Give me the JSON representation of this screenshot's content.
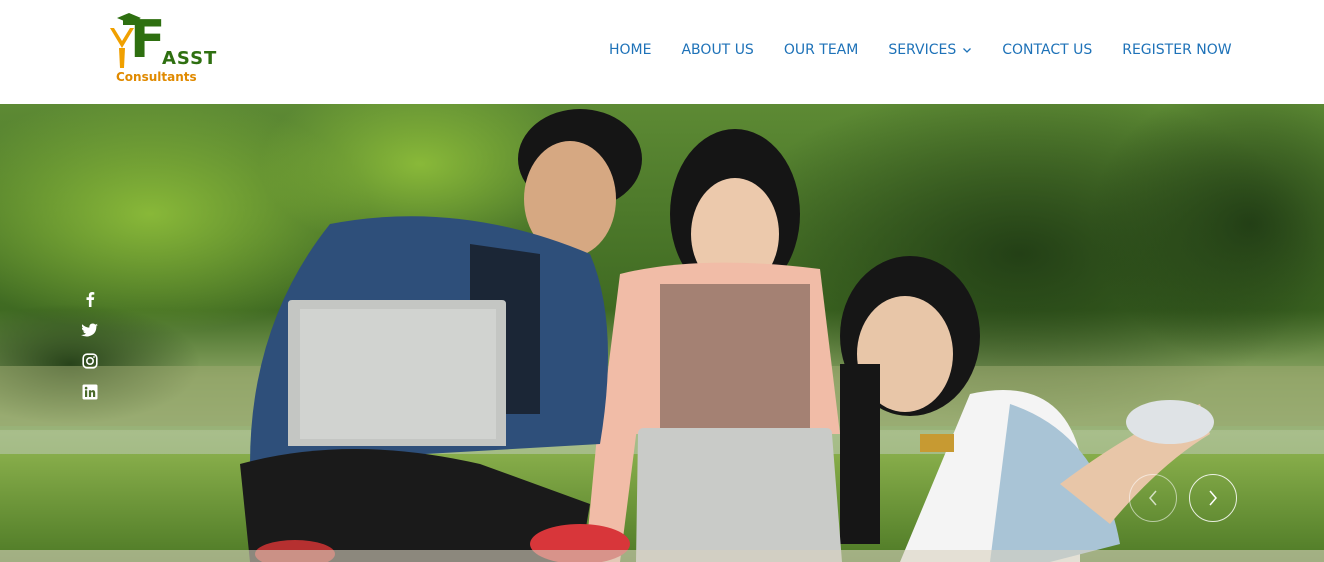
{
  "site": {
    "logo": {
      "letter": "F",
      "name": "ASST",
      "subtitle": "Consultants"
    }
  },
  "nav": {
    "items": [
      {
        "label": "HOME"
      },
      {
        "label": "ABOUT US"
      },
      {
        "label": "OUR TEAM"
      },
      {
        "label": "SERVICES",
        "has_dropdown": true
      },
      {
        "label": "CONTACT US"
      },
      {
        "label": "REGISTER NOW"
      }
    ]
  },
  "hero": {
    "social_icons": [
      "facebook-icon",
      "twitter-icon",
      "instagram-icon",
      "linkedin-icon"
    ],
    "controls": {
      "prev_icon": "chevron-left-icon",
      "next_icon": "chevron-right-icon"
    }
  },
  "colors": {
    "nav_text": "#1e72b8",
    "logo_green": "#2e6f10",
    "logo_orange": "#e08a00"
  }
}
